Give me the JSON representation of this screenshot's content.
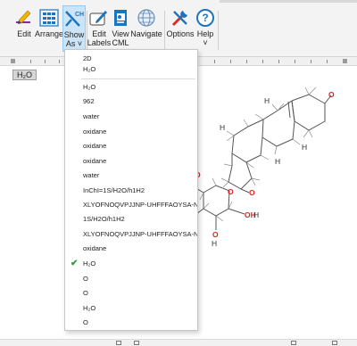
{
  "ribbon": {
    "edit_label": "Edit",
    "arrange_label": "Arrange",
    "show_as_line1": "Show",
    "show_as_line2": "As",
    "show_as_badge": "CH",
    "edit_labels_line1": "Edit",
    "edit_labels_line2": "Labels",
    "view_cml_line1": "View",
    "view_cml_line2": "CML",
    "navigate_label": "Navigate",
    "options_label": "Options",
    "help_label": "Help",
    "group_tag": "m"
  },
  "canvas": {
    "selected_tag": "H₂O"
  },
  "menu": {
    "top_items": [
      "2D",
      "H₂O"
    ],
    "items": [
      "H₂O",
      "962",
      "water",
      "oxidane",
      "oxidane",
      "oxidane",
      "water",
      "InChI=1S/H2O/h1H2",
      "XLYOFNOQVPJJNP-UHFFFAOYSA-N",
      "1S/H2O/h1H2",
      "XLYOFNOQVPJJNP-UHFFFAOYSA-N",
      "oxidane",
      "H₂O",
      "O",
      "O",
      "H₂O",
      "O"
    ],
    "checked_index": 12,
    "check_glyph": "✔"
  },
  "molecule": {
    "atom_O": "O",
    "atom_H": "H",
    "atom_HO": "HO",
    "atom_OH": "OH"
  },
  "colors": {
    "accent": "#1e73be",
    "check": "#2e9b3a",
    "oxygen": "#e02020",
    "active_button": "#cce4f7"
  },
  "icons": [
    "edit-icon",
    "arrange-icon",
    "show-as-icon",
    "edit-labels-icon",
    "view-cml-icon",
    "navigate-icon",
    "options-icon",
    "help-icon"
  ]
}
